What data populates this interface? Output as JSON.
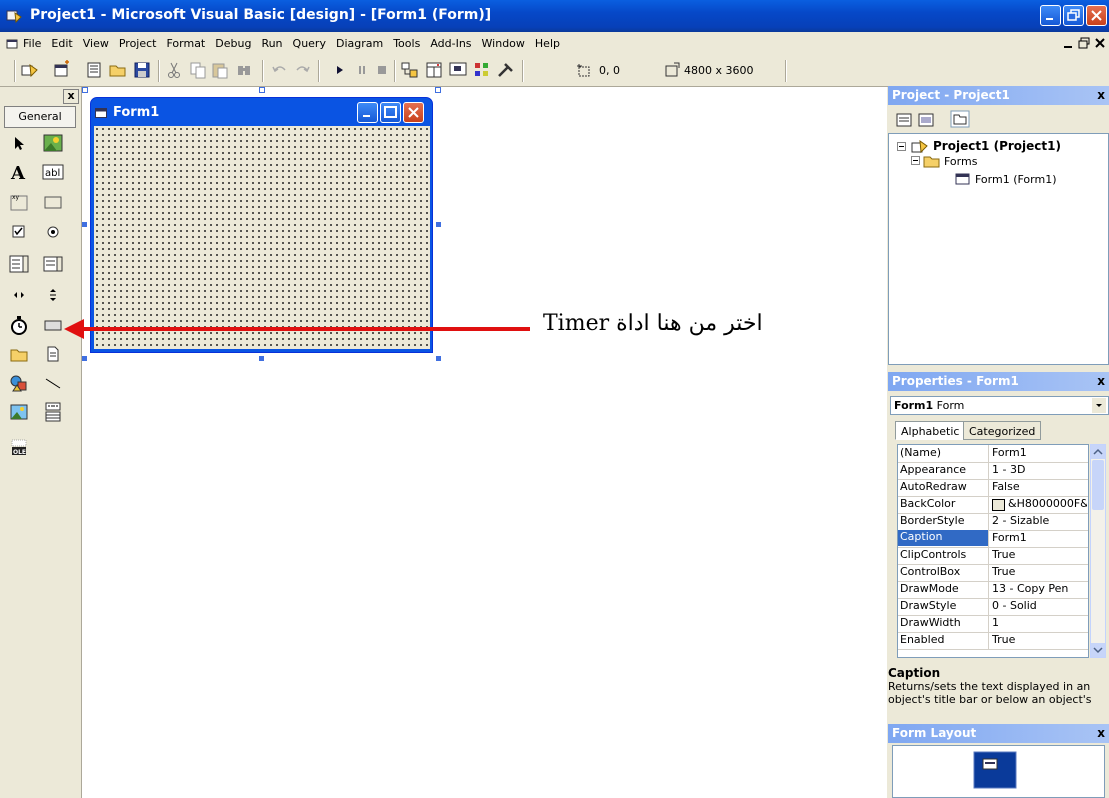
{
  "window": {
    "title": "Project1 - Microsoft Visual Basic [design] - [Form1 (Form)]"
  },
  "menu": {
    "items": [
      "File",
      "Edit",
      "View",
      "Project",
      "Format",
      "Debug",
      "Run",
      "Query",
      "Diagram",
      "Tools",
      "Add-Ins",
      "Window",
      "Help"
    ],
    "mdi_buttons": "_ 0 x"
  },
  "toolbar": {
    "coords": "0, 0",
    "size": "4800 x 3600"
  },
  "toolbox": {
    "close": "x",
    "tab": "General",
    "tools": [
      "pointer",
      "picturebox",
      "label",
      "textbox",
      "frame",
      "commandbutton",
      "checkbox",
      "optionbutton",
      "combobox",
      "listbox",
      "hscrollbar",
      "vscrollbar",
      "timer",
      "drivelistbox",
      "dirlistbox",
      "filelistbox",
      "shape",
      "line",
      "image",
      "data",
      "ole"
    ]
  },
  "form": {
    "title": "Form1"
  },
  "annotation": {
    "text": "Timer اختر من هنا اداة"
  },
  "project_panel": {
    "title": "Project - Project1",
    "close": "x",
    "root": "Project1 (Project1)",
    "folder": "Forms",
    "item": "Form1 (Form1)"
  },
  "properties_panel": {
    "title": "Properties - Form1",
    "close": "x",
    "object_name": "Form1",
    "object_type": "Form",
    "tabs": [
      "Alphabetic",
      "Categorized"
    ],
    "selected_row": "Caption",
    "rows": [
      {
        "name": "(Name)",
        "value": "Form1"
      },
      {
        "name": "Appearance",
        "value": "1 - 3D"
      },
      {
        "name": "AutoRedraw",
        "value": "False"
      },
      {
        "name": "BackColor",
        "value": "&H8000000F&"
      },
      {
        "name": "BorderStyle",
        "value": "2 - Sizable"
      },
      {
        "name": "Caption",
        "value": "Form1"
      },
      {
        "name": "ClipControls",
        "value": "True"
      },
      {
        "name": "ControlBox",
        "value": "True"
      },
      {
        "name": "DrawMode",
        "value": "13 - Copy Pen"
      },
      {
        "name": "DrawStyle",
        "value": "0 - Solid"
      },
      {
        "name": "DrawWidth",
        "value": "1"
      },
      {
        "name": "Enabled",
        "value": "True"
      }
    ],
    "desc_title": "Caption",
    "desc_text": "Returns/sets the text displayed in an object's title bar or below an object's"
  },
  "form_layout_panel": {
    "title": "Form Layout",
    "close": "x"
  },
  "colors": {
    "xp_blue": "#0A54E3",
    "selection": "#316AC5",
    "arrow": "#E01010"
  }
}
